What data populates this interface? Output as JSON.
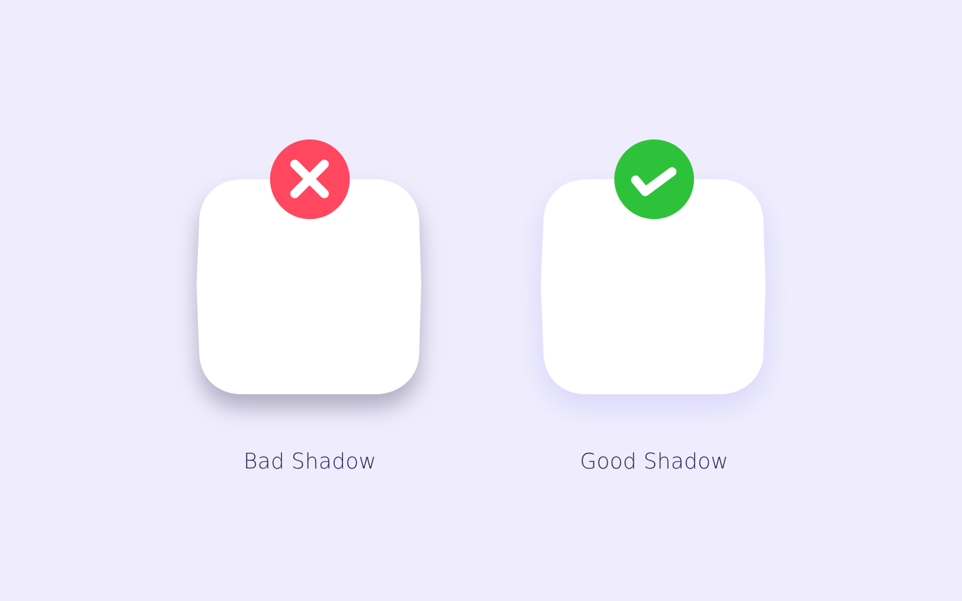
{
  "examples": [
    {
      "id": "bad",
      "label": "Bad Shadow",
      "badge_icon": "close-icon",
      "badge_color": "#ff4760",
      "shadow_color": "#9c97b0"
    },
    {
      "id": "good",
      "label": "Good Shadow",
      "badge_icon": "check-icon",
      "badge_color": "#2ec23a",
      "shadow_color": "#d6d3fb"
    }
  ],
  "colors": {
    "background": "#efedfd",
    "card": "#ffffff",
    "label_text": "#24235a",
    "icon_stroke": "#ffffff"
  }
}
